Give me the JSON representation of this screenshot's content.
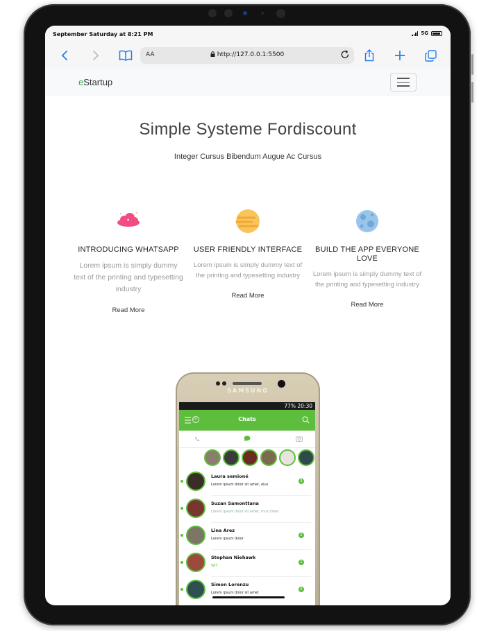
{
  "status_bar": {
    "time": "September Saturday at 8:21 PM",
    "network": "5G"
  },
  "browser": {
    "text_size": "AA",
    "url": "http://127.0.0.1:5500"
  },
  "navbar": {
    "brand_prefix": "e",
    "brand_rest": "Startup"
  },
  "hero": {
    "title": "Simple Systeme Fordiscount",
    "subtitle": "Integer Cursus Bibendum Augue Ac Cursus"
  },
  "features": [
    {
      "icon": "cloud-icon",
      "title": "INTRODUCING WHATSAPP",
      "text": "Lorem ipsum is simply dummy text of the printing and typesetting industry",
      "link": "Read More"
    },
    {
      "icon": "planet-icon",
      "title": "USER FRIENDLY INTERFACE",
      "text": "Lorem ipsum is simply dummy text of the printing and typesetting industry",
      "link": "Read More"
    },
    {
      "icon": "moon-icon",
      "title": "BUILD THE APP EVERYONE LOVE",
      "text": "Lorem ipsum is simply dummy text of the printing and typesetting industry",
      "link": "Read More"
    }
  ],
  "phone": {
    "brand": "SAMSUNG",
    "status": "77% 20:30",
    "app_title": "Chats",
    "menu_badge": "24",
    "chats": [
      {
        "name": "Laura semioné",
        "message": "Lorem ipsum dolor sit amet, elus",
        "badge": "3"
      },
      {
        "name": "Suzan Samonttana",
        "message": "Lorem ipsum dolor sit amet, mus dinec",
        "badge": ""
      },
      {
        "name": "Lina Arez",
        "message": "Lorem ipsum dolor",
        "badge": "5"
      },
      {
        "name": "Stephan Niehawk",
        "message": "WIT",
        "badge": "1"
      },
      {
        "name": "Simon Lorenzu",
        "message": "Lorem ipsum dolor sit amet",
        "badge": "6"
      }
    ]
  },
  "colors": {
    "brand_green": "#35a84a",
    "app_green": "#5dbd3c",
    "accent_blue": "#1a7cf5"
  }
}
